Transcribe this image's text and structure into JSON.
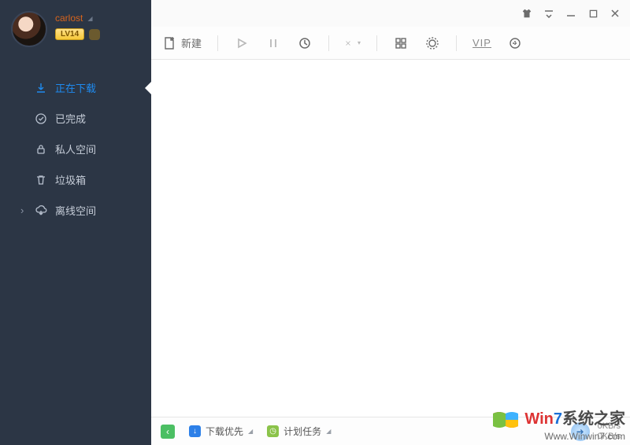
{
  "profile": {
    "username": "carlost",
    "level_label": "LV14"
  },
  "sidebar": {
    "items": [
      {
        "label": "正在下载",
        "icon": "download-icon",
        "active": true
      },
      {
        "label": "已完成",
        "icon": "check-circle-icon"
      },
      {
        "label": "私人空间",
        "icon": "lock-icon"
      },
      {
        "label": "垃圾箱",
        "icon": "trash-icon"
      },
      {
        "label": "离线空间",
        "icon": "cloud-download-icon",
        "expandable": true
      }
    ]
  },
  "toolbar": {
    "new_label": "新建",
    "vip_label": "VIP"
  },
  "statusbar": {
    "priority_label": "下载优先",
    "schedule_label": "计划任务",
    "down_speed": "0KB/s",
    "up_speed": "0KB/s"
  },
  "watermark": {
    "line1_prefix": "Win",
    "line1_seven": "7",
    "line1_suffix": "系统之家",
    "line2": "Www.Winwin7.com"
  }
}
